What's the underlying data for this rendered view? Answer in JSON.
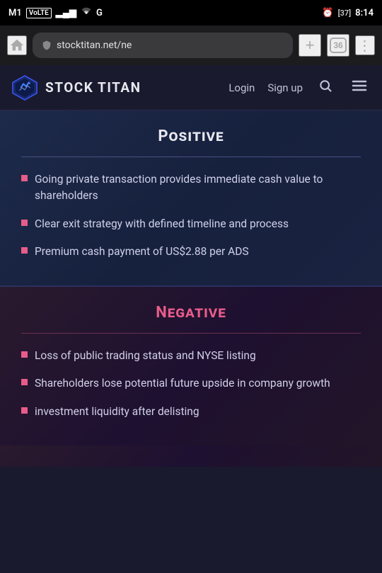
{
  "status_bar": {
    "carrier": "M1",
    "carrier_type": "VoLTE",
    "signal_bars": "▂▄▆",
    "wifi": "WiFi",
    "network_type": "G",
    "alarm_icon": "⏰",
    "battery_level": "37",
    "time": "8:14"
  },
  "browser": {
    "home_icon": "⌂",
    "url": "stocktitan.net/ne",
    "add_tab_icon": "+",
    "tabs_count": "36",
    "more_icon": "⋮"
  },
  "site_header": {
    "logo_text": "STOCK TITAN",
    "nav_login": "Login",
    "nav_signup": "Sign up",
    "search_icon": "🔍",
    "menu_icon": "≡"
  },
  "positive_section": {
    "title": "Positive",
    "bullets": [
      "Going private transaction provides immediate cash value to shareholders",
      "Clear exit strategy with defined timeline and process",
      "Premium cash payment of US$2.88 per ADS"
    ]
  },
  "negative_section": {
    "title": "Negative",
    "bullets": [
      "Loss of public trading status and NYSE listing",
      "Shareholders lose potential future upside in company growth",
      "investment liquidity after delisting"
    ]
  }
}
